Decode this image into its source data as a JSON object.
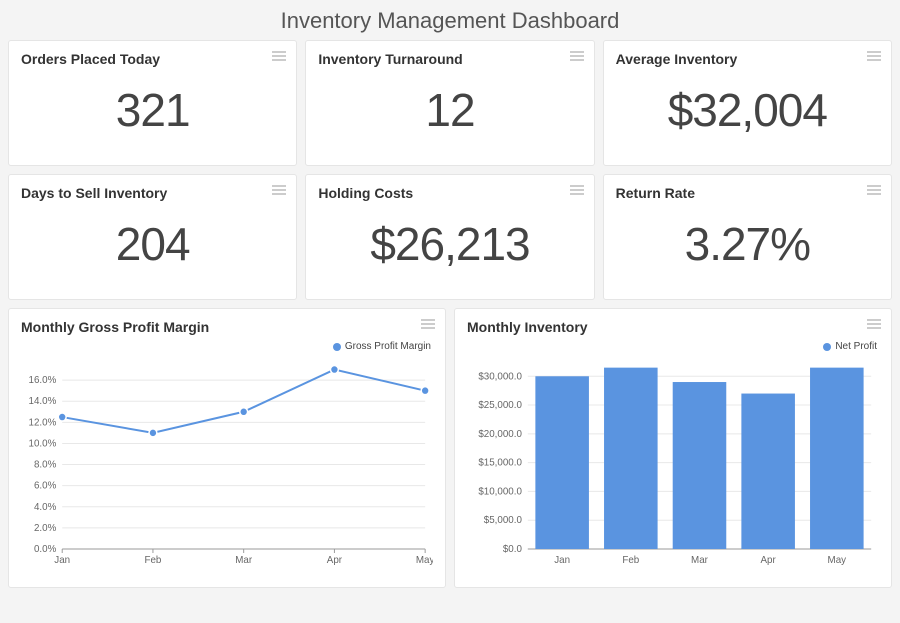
{
  "title": "Inventory Management Dashboard",
  "kpis": [
    {
      "label": "Orders Placed Today",
      "value": "321"
    },
    {
      "label": "Inventory Turnaround",
      "value": "12"
    },
    {
      "label": "Average Inventory",
      "value": "$32,004"
    },
    {
      "label": "Days to Sell Inventory",
      "value": "204"
    },
    {
      "label": "Holding Costs",
      "value": "$26,213"
    },
    {
      "label": "Return Rate",
      "value": "3.27%"
    }
  ],
  "line_chart": {
    "title": "Monthly Gross Profit Margin",
    "legend": "Gross Profit Margin"
  },
  "bar_chart": {
    "title": "Monthly Inventory",
    "legend": "Net Profit"
  },
  "chart_data": [
    {
      "type": "line",
      "title": "Monthly Gross Profit Margin",
      "series": [
        {
          "name": "Gross Profit Margin",
          "values": [
            12.5,
            11.0,
            13.0,
            17.0,
            15.0
          ]
        }
      ],
      "categories": [
        "Jan",
        "Feb",
        "Mar",
        "Apr",
        "May"
      ],
      "xlabel": "",
      "ylabel": "",
      "y_ticks": [
        0,
        2,
        4,
        6,
        8,
        10,
        12,
        14,
        16
      ],
      "y_tick_labels": [
        "0.0%",
        "2.0%",
        "4.0%",
        "6.0%",
        "8.0%",
        "10.0%",
        "12.0%",
        "14.0%",
        "16.0%"
      ],
      "ylim": [
        0,
        18
      ]
    },
    {
      "type": "bar",
      "title": "Monthly Inventory",
      "series": [
        {
          "name": "Net Profit",
          "values": [
            30000,
            31500,
            29000,
            27000,
            31500
          ]
        }
      ],
      "categories": [
        "Jan",
        "Feb",
        "Mar",
        "Apr",
        "May"
      ],
      "xlabel": "",
      "ylabel": "",
      "y_ticks": [
        0,
        5000,
        10000,
        15000,
        20000,
        25000,
        30000
      ],
      "y_tick_labels": [
        "$0.0",
        "$5,000.0",
        "$10,000.0",
        "$15,000.0",
        "$20,000.0",
        "$25,000.0",
        "$30,000.0"
      ],
      "ylim": [
        0,
        33000
      ]
    }
  ]
}
